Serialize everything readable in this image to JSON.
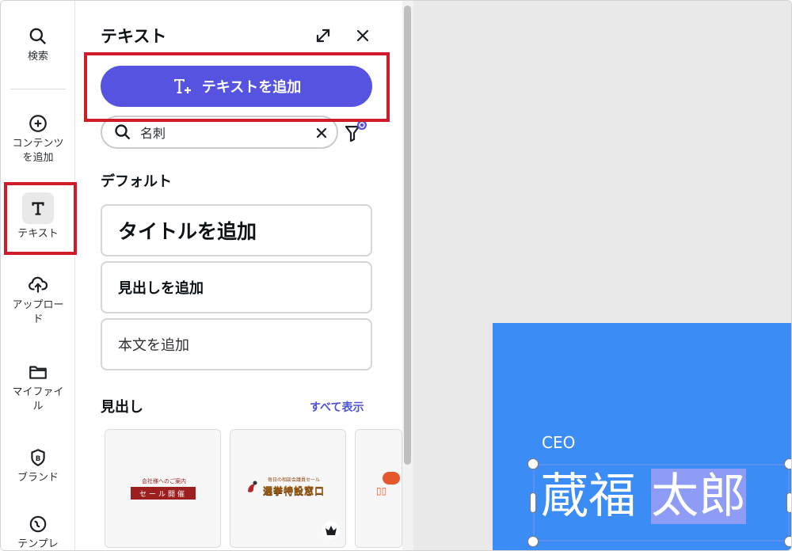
{
  "rail": {
    "items": [
      {
        "label": "検索",
        "icon": "search-icon"
      },
      {
        "label": "コンテンツ\nを追加",
        "icon": "plus-circle-icon"
      },
      {
        "label": "テキスト",
        "icon": "text-icon"
      },
      {
        "label": "アップロー\nド",
        "icon": "cloud-upload-icon"
      },
      {
        "label": "マイファイ\nル",
        "icon": "folder-icon"
      },
      {
        "label": "ブランド",
        "icon": "brand-icon"
      },
      {
        "label": "テンプレ",
        "icon": "template-icon"
      }
    ]
  },
  "panel": {
    "title": "テキスト",
    "add_text_label": "テキストを追加",
    "search": {
      "value": "名刺"
    },
    "default_section": "デフォルト",
    "default_styles": {
      "title": "タイトルを追加",
      "heading": "見出しを追加",
      "body": "本文を追加"
    },
    "headings_section": "見出し",
    "see_all": "すべて表示",
    "thumbs": [
      {
        "top": "会社様へのご案内",
        "main": "セール開催"
      },
      {
        "top": "毎日の相談会議員セール",
        "main": "選挙特設窓口"
      }
    ]
  },
  "canvas": {
    "ceo": "CEO",
    "name_part1": "蔵福",
    "name_part2": "太郎",
    "card_color": "#3b8cf5"
  },
  "colors": {
    "accent": "#5553e0",
    "highlight_box": "#d11a2a"
  }
}
